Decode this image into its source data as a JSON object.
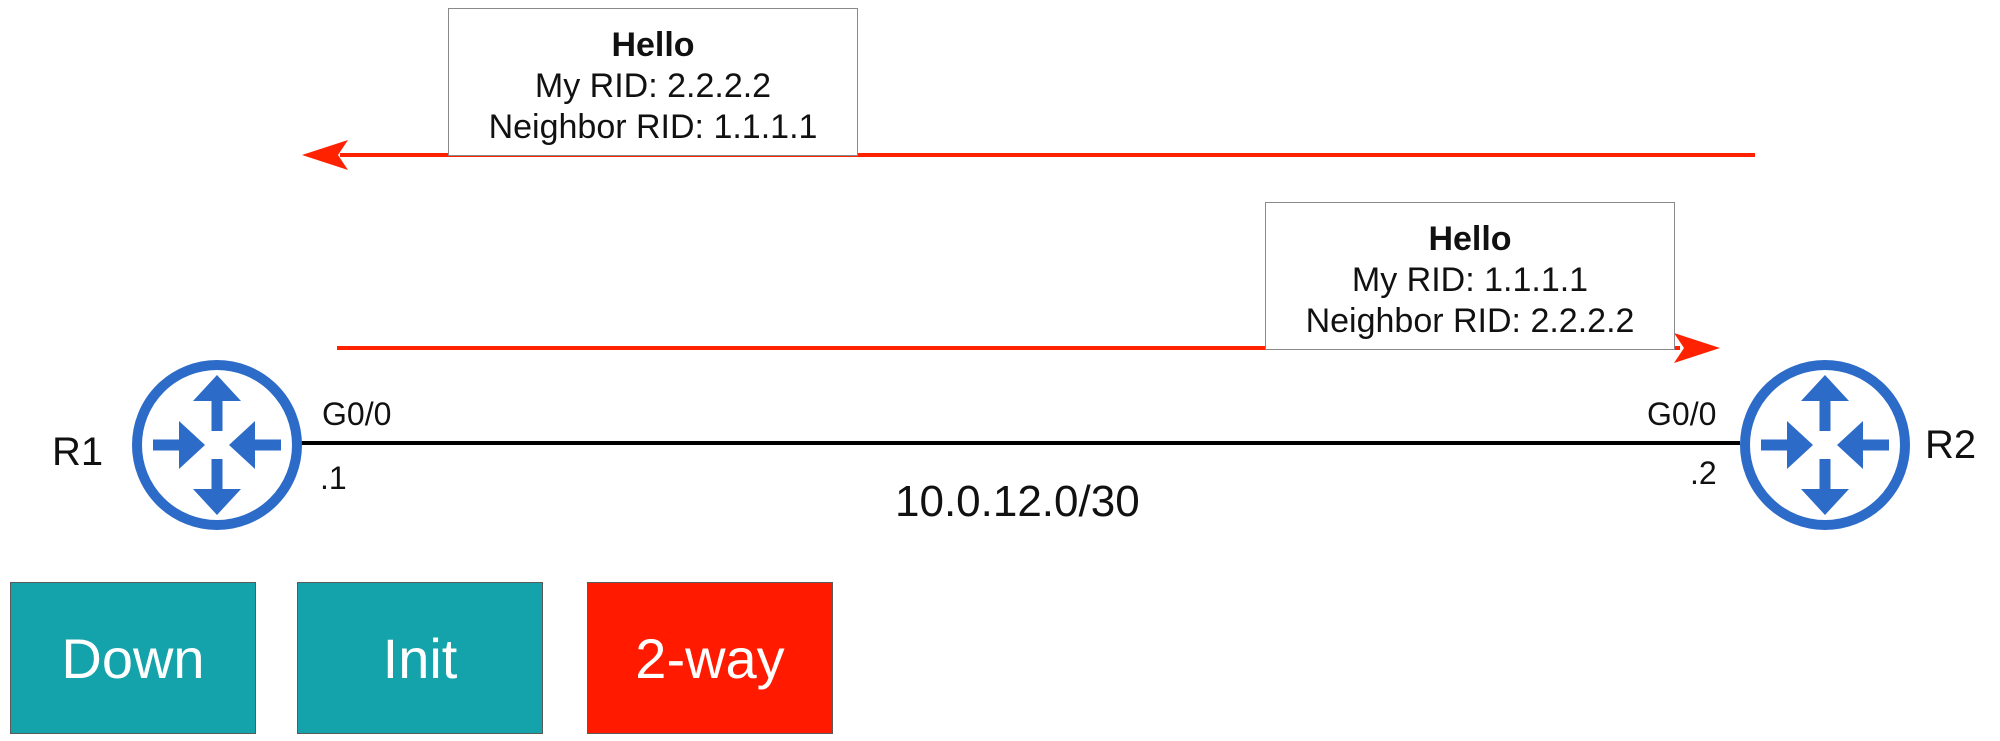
{
  "hello_top": {
    "title": "Hello",
    "my_rid": "My RID: 2.2.2.2",
    "neighbor_rid": "Neighbor RID: 1.1.1.1"
  },
  "hello_bottom": {
    "title": "Hello",
    "my_rid": "My RID: 1.1.1.1",
    "neighbor_rid": "Neighbor RID: 2.2.2.2"
  },
  "r1": {
    "name": "R1",
    "interface": "G0/0",
    "ip_suffix": ".1",
    "icon": "router-icon"
  },
  "r2": {
    "name": "R2",
    "interface": "G0/0",
    "ip_suffix": ".2",
    "icon": "router-icon"
  },
  "link": {
    "subnet": "10.0.12.0/30"
  },
  "states": [
    {
      "label": "Down",
      "color": "#15a3ab"
    },
    {
      "label": "Init",
      "color": "#15a3ab"
    },
    {
      "label": "2-way",
      "color": "#ff1a00"
    }
  ],
  "colors": {
    "arrow": "#ff2200",
    "router": "#2d6bc9",
    "link": "#000000"
  }
}
